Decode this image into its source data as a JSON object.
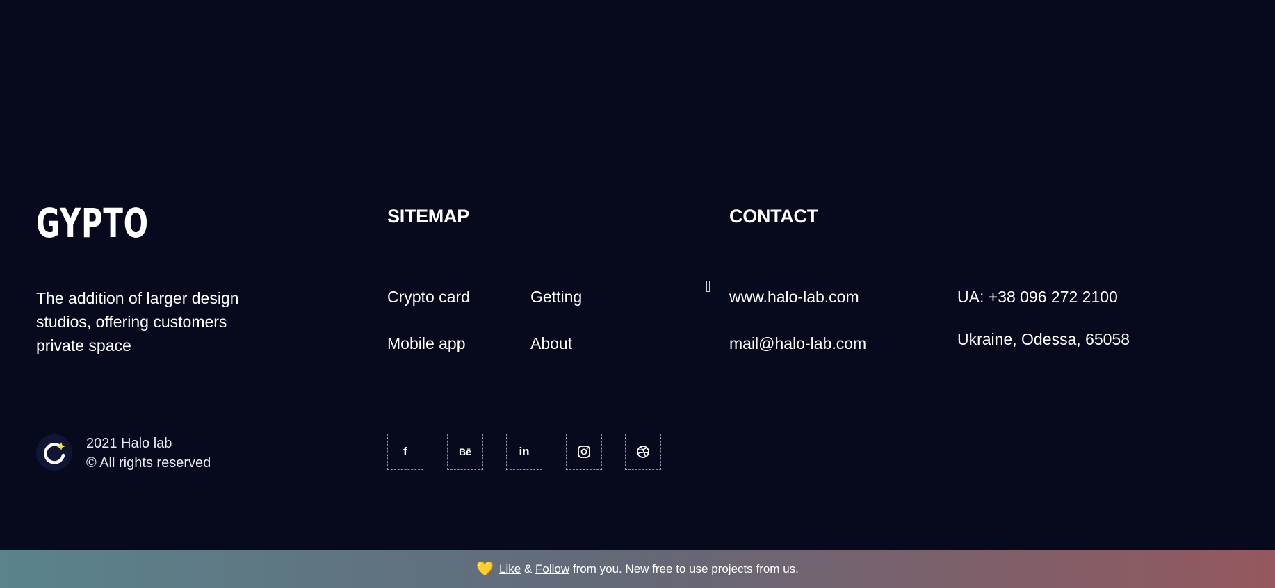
{
  "brand": {
    "logo": "GYPTO",
    "tagline": "The addition of larger design studios, offering customers private space"
  },
  "sitemap": {
    "title": "SITEMAP",
    "links": [
      "Crypto card",
      "Getting",
      "Mobile app",
      "About"
    ]
  },
  "contact": {
    "title": "CONTACT",
    "website": "www.halo-lab.com",
    "phone": "UA: +38 096 272 2100",
    "email": "mail@halo-lab.com",
    "address": "Ukraine, Odessa, 65058"
  },
  "footer": {
    "year_line": "2021 Halo lab",
    "rights_line": "© All rights reserved"
  },
  "social": [
    {
      "icon": "facebook-icon",
      "glyph": "f"
    },
    {
      "icon": "behance-icon",
      "glyph": "Bē"
    },
    {
      "icon": "linkedin-icon",
      "glyph": "in"
    },
    {
      "icon": "instagram-icon",
      "glyph": ""
    },
    {
      "icon": "dribbble-icon",
      "glyph": ""
    }
  ],
  "banner": {
    "like": "Like",
    "amp": " & ",
    "follow": "Follow",
    "rest": " from you. New free to use projects from us."
  },
  "colors": {
    "background": "#070a1c",
    "accent_yellow": "#f2e233",
    "banner_start": "#5a838c",
    "banner_end": "#94585e"
  }
}
